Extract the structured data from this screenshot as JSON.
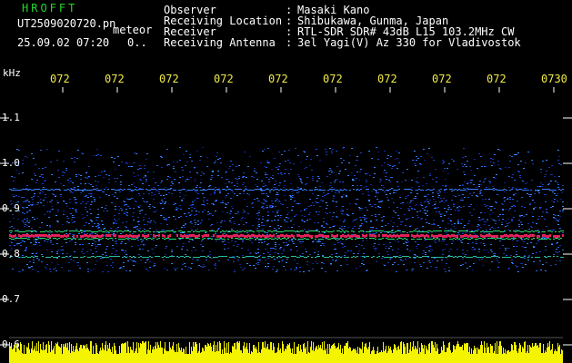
{
  "header": {
    "app_title": "HROFFT",
    "file_name": "UT2509020720.pn",
    "file_suffix": "meteor",
    "date_time": "25.09.02 07:20",
    "counter": "0.."
  },
  "info": [
    {
      "key": "Observer",
      "value": "Masaki Kano"
    },
    {
      "key": "Receiving Location",
      "value": "Shibukawa, Gunma, Japan"
    },
    {
      "key": "Receiver",
      "value": "RTL-SDR SDR# 43dB L15 103.2MHz CW"
    },
    {
      "key": "Receiving Antenna",
      "value": "3el Yagi(V) Az 330 for Vladivostok"
    }
  ],
  "info_separator": ":",
  "axis": {
    "unit": "kHz",
    "freq_ticks": [
      "1.1",
      "1.0",
      "0.9",
      "0.8",
      "0.7",
      "0.6"
    ],
    "time_ticks": [
      "072",
      "072",
      "072",
      "072",
      "072",
      "072",
      "072",
      "072",
      "072",
      "0730"
    ]
  },
  "colors": {
    "background": "#000000",
    "title": "#21d82b",
    "time_labels": "#f1ea47",
    "noise_low": "#0a1e8c",
    "noise_high": "#2c7bff",
    "band_red": "#e0205a",
    "band_green": "#28e07a",
    "amplitude": "#f4f400"
  }
}
